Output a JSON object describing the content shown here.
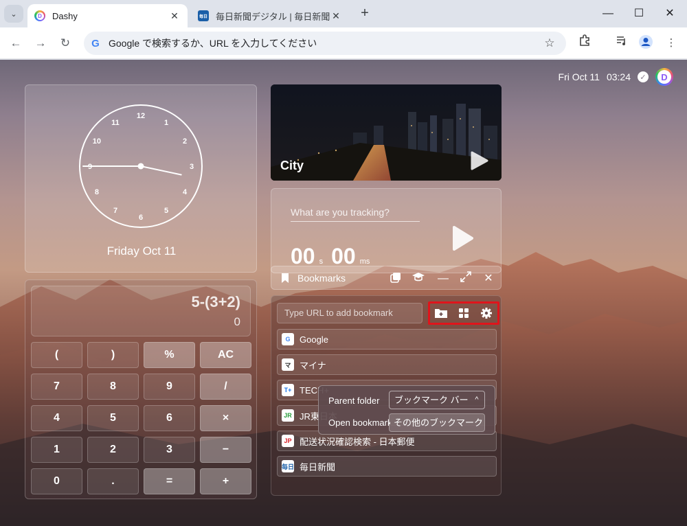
{
  "browser": {
    "tabs": [
      {
        "label": "Dashy",
        "favicon": "D",
        "active": true
      },
      {
        "label": "毎日新聞デジタル | 毎日新聞のニュ",
        "favicon": "毎日",
        "active": false
      }
    ],
    "omnibox_placeholder": "Google で検索するか、URL を入力してください"
  },
  "dashboard": {
    "date": "Fri Oct 11",
    "time": "03:24",
    "avatar_letter": "D"
  },
  "clock": {
    "numbers": [
      "12",
      "1",
      "2",
      "3",
      "4",
      "5",
      "6",
      "7",
      "8",
      "9",
      "10",
      "11"
    ],
    "hour": 3,
    "minute": 24,
    "second": 45,
    "date_label": "Friday Oct 11"
  },
  "video": {
    "title": "City"
  },
  "tracker": {
    "placeholder": "What are you tracking?",
    "seconds": "00",
    "seconds_unit": "s",
    "milliseconds": "00",
    "milliseconds_unit": "ms"
  },
  "bookmarks": {
    "title": "Bookmarks",
    "input_placeholder": "Type URL to add bookmark",
    "items": [
      {
        "label": "Google",
        "favicon": "G",
        "color": "#4285f4"
      },
      {
        "label": "マイナ",
        "favicon": "マ",
        "color": "#333333"
      },
      {
        "label": "TECH+",
        "favicon": "T+",
        "color": "#1a73e8"
      },
      {
        "label": "JR東日本",
        "favicon": "JR",
        "color": "#2a9d3c"
      },
      {
        "label": "配送状況確認検索 - 日本郵便",
        "favicon": "JP",
        "color": "#d8222a"
      },
      {
        "label": "毎日新聞",
        "favicon": "毎日",
        "color": "#1b5fa8"
      }
    ],
    "popover": {
      "parent_folder_label": "Parent folder",
      "parent_folder_value": "ブックマーク バー",
      "open_bookmarks_label": "Open bookmarks in",
      "open_bookmarks_value": "その他のブックマーク"
    }
  },
  "calculator": {
    "expression": "5-(3+2)",
    "result": "0",
    "keys": [
      "(",
      ")",
      "%",
      "AC",
      "7",
      "8",
      "9",
      "/",
      "4",
      "5",
      "6",
      "×",
      "1",
      "2",
      "3",
      "−",
      "0",
      ".",
      "=",
      "+"
    ]
  }
}
